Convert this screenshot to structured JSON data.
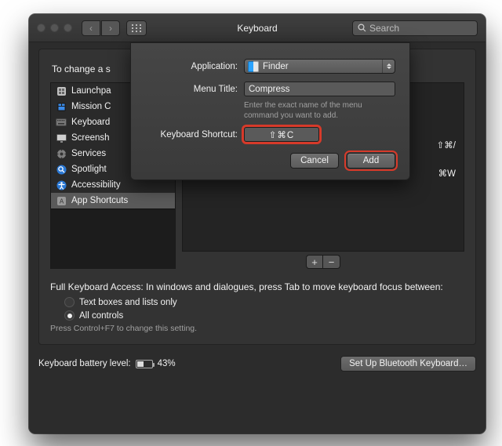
{
  "window": {
    "title": "Keyboard"
  },
  "search": {
    "placeholder": "Search"
  },
  "intro_template": "To change a shortcut, select it, double-click the key combination, then type the new keys.",
  "intro_visible": "To change a s",
  "sidebar": {
    "items": [
      {
        "label": "Launchpad & Dock",
        "visible": "Launchpa",
        "icon": "launchpad-icon",
        "color": "#c0c0c0"
      },
      {
        "label": "Mission Control",
        "visible": "Mission C",
        "icon": "mission-control-icon",
        "color": "#1e1e1e"
      },
      {
        "label": "Keyboard",
        "visible": "Keyboard",
        "icon": "keyboard-icon",
        "color": "#777777"
      },
      {
        "label": "Screenshots",
        "visible": "Screensh",
        "icon": "screenshot-icon",
        "color": "#cfcfcf"
      },
      {
        "label": "Services",
        "visible": "Services",
        "icon": "services-icon",
        "color": "#808080"
      },
      {
        "label": "Spotlight",
        "visible": "Spotlight",
        "icon": "spotlight-icon",
        "color": "#2a78d4"
      },
      {
        "label": "Accessibility",
        "visible": "Accessibility",
        "icon": "accessibility-icon",
        "color": "#2a78d4"
      },
      {
        "label": "App Shortcuts",
        "visible": "App Shortcuts",
        "icon": "app-shortcuts-icon",
        "color": "#9a9a9a",
        "selected": true
      }
    ]
  },
  "existing_shortcuts": [
    {
      "keys": "⇧⌘/",
      "visible": true
    },
    {
      "keys": "⌘W",
      "visible": true
    }
  ],
  "kb_access": {
    "heading": "Full Keyboard Access: In windows and dialogues, press Tab to move keyboard focus between:",
    "options": [
      {
        "label": "Text boxes and lists only",
        "selected": false
      },
      {
        "label": "All controls",
        "selected": true
      }
    ],
    "note": "Press Control+F7 to change this setting."
  },
  "battery": {
    "label": "Keyboard battery level:",
    "percent_text": "43%",
    "percent_value": 43
  },
  "bluetooth_btn": "Set Up Bluetooth Keyboard…",
  "dialog": {
    "labels": {
      "application": "Application:",
      "menu_title": "Menu Title:",
      "keyboard_shortcut": "Keyboard Shortcut:"
    },
    "application_value": "Finder",
    "menu_title_value": "Compress",
    "hint": "Enter the exact name of the menu command you want to add.",
    "shortcut_value": "⇧⌘C",
    "cancel": "Cancel",
    "add": "Add"
  },
  "glyphs": {
    "chevron_left": "‹",
    "chevron_right": "›",
    "plus": "+",
    "minus": "−"
  }
}
